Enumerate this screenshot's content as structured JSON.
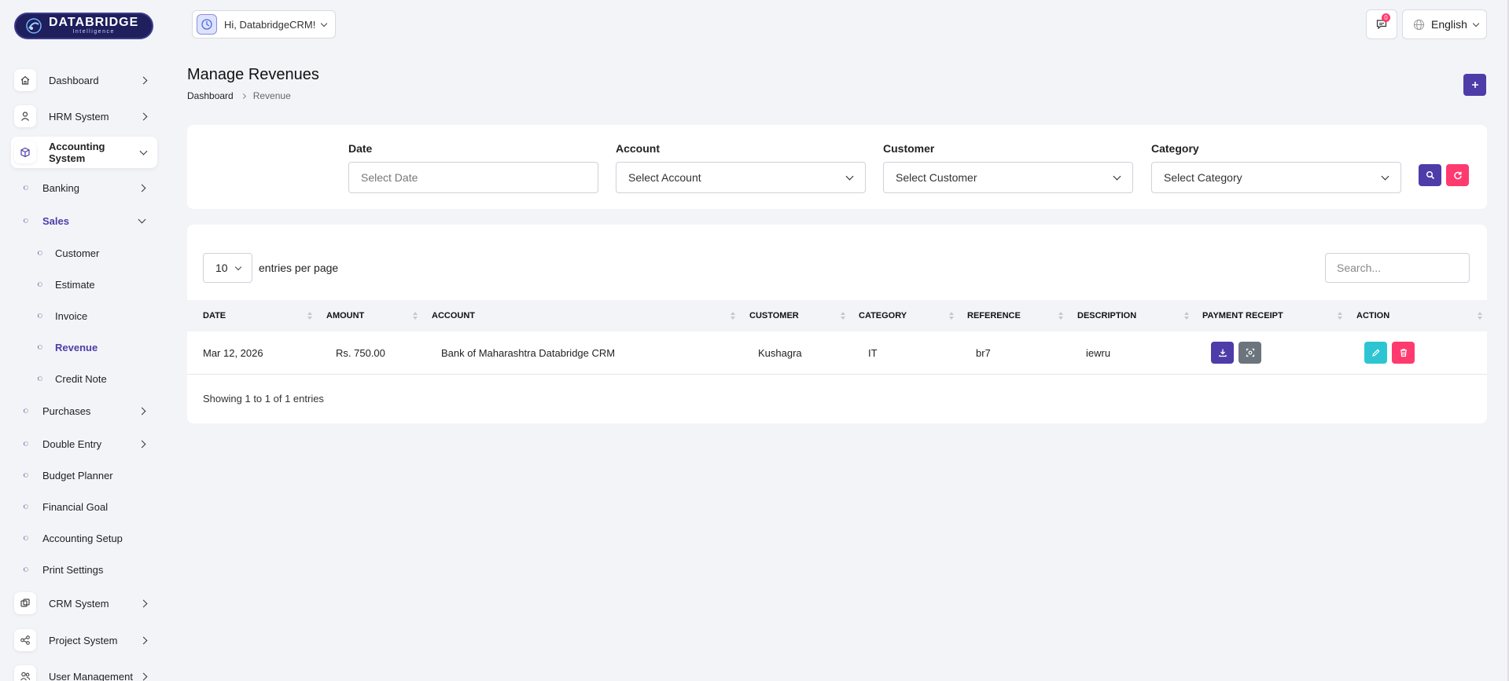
{
  "brand": {
    "name": "DATABRIDGE",
    "tagline": "Intelligence"
  },
  "sidebar": {
    "items": [
      {
        "label": "Dashboard",
        "icon": "home-icon"
      },
      {
        "label": "HRM System",
        "icon": "user-icon"
      },
      {
        "label": "Accounting System",
        "icon": "box-icon"
      },
      {
        "label": "CRM System",
        "icon": "layers-icon"
      },
      {
        "label": "Project System",
        "icon": "share-icon"
      },
      {
        "label": "User Management",
        "icon": "users-icon"
      }
    ],
    "accounting": {
      "banking": "Banking",
      "sales": "Sales",
      "sales_items": [
        "Customer",
        "Estimate",
        "Invoice",
        "Revenue",
        "Credit Note"
      ],
      "purchases": "Purchases",
      "double_entry": "Double Entry",
      "budget_planner": "Budget Planner",
      "financial_goal": "Financial Goal",
      "accounting_setup": "Accounting Setup",
      "print_settings": "Print Settings"
    }
  },
  "header": {
    "greeting": "Hi, DatabridgeCRM!",
    "messages_count": "0",
    "language": "English"
  },
  "page": {
    "title": "Manage Revenues",
    "breadcrumb": [
      "Dashboard",
      "Revenue"
    ]
  },
  "filters": {
    "date_label": "Date",
    "date_placeholder": "Select Date",
    "account_label": "Account",
    "account_value": "Select Account",
    "customer_label": "Customer",
    "customer_value": "Select Customer",
    "category_label": "Category",
    "category_value": "Select Category"
  },
  "table": {
    "page_length": "10",
    "page_length_label": "entries per page",
    "search_placeholder": "Search...",
    "columns": [
      "DATE",
      "AMOUNT",
      "ACCOUNT",
      "CUSTOMER",
      "CATEGORY",
      "REFERENCE",
      "DESCRIPTION",
      "PAYMENT RECEIPT",
      "ACTION"
    ],
    "rows": [
      {
        "date": "Mar 12, 2026",
        "amount": "Rs. 750.00",
        "account": "Bank of Maharashtra Databridge CRM",
        "customer": "Kushagra",
        "category": "IT",
        "reference": "br7",
        "description": "iewru"
      }
    ],
    "info": "Showing 1 to 1 of 1 entries"
  },
  "colors": {
    "primary": "#4e3ca8",
    "danger": "#ff3a6e",
    "info": "#2ec5d3",
    "secondary": "#6c757d"
  }
}
